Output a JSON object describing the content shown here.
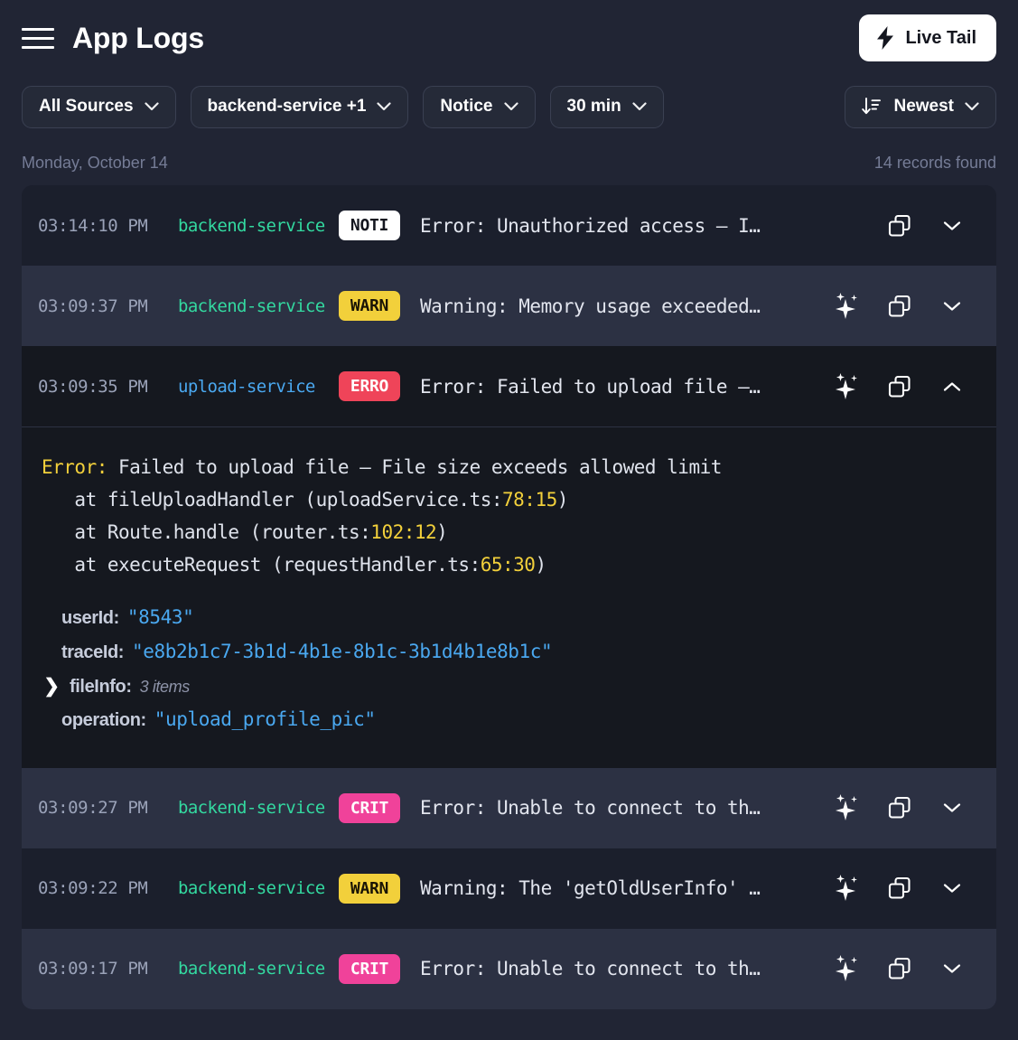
{
  "header": {
    "menu_icon": "hamburger-icon",
    "title": "App Logs",
    "live_tail_label": "Live Tail",
    "live_tail_icon": "bolt-icon"
  },
  "filters": [
    {
      "label": "All Sources",
      "icon": "chevron-down-icon"
    },
    {
      "label": "backend-service +1",
      "icon": "chevron-down-icon"
    },
    {
      "label": "Notice",
      "icon": "chevron-down-icon"
    },
    {
      "label": "30 min",
      "icon": "chevron-down-icon"
    }
  ],
  "sort": {
    "label": "Newest",
    "lead_icon": "sort-descending-icon",
    "icon": "chevron-down-icon"
  },
  "meta": {
    "date": "Monday, October 14",
    "records": "14 records found"
  },
  "colors": {
    "page_bg": "#212534",
    "row_bg": "#1b1f2c",
    "row_bg_alt": "#2c3143",
    "detail_bg": "#15181f",
    "source_green": "#33d9a0",
    "source_blue": "#4aa8f0",
    "noti": "#ffffff",
    "warn": "#f2d03b",
    "erro": "#ef4459",
    "crit": "#f0429a",
    "value_blue": "#4aa8f0",
    "accent_yellow": "#f2d03b"
  },
  "rows": [
    {
      "time": "03:14:10 PM",
      "source": "backend-service",
      "source_color": "green",
      "level": "NOTI",
      "level_class": "noti",
      "message": "Error: Unauthorized access — I…",
      "has_sparkle": false,
      "copy_icon": "copy-icon",
      "toggle_icon": "chevron-down-icon",
      "expanded": false
    },
    {
      "time": "03:09:37 PM",
      "source": "backend-service",
      "source_color": "green",
      "level": "WARN",
      "level_class": "warn",
      "message": "Warning: Memory usage exceeded…",
      "has_sparkle": true,
      "sparkle_icon": "sparkles-icon",
      "copy_icon": "copy-icon",
      "toggle_icon": "chevron-down-icon",
      "expanded": false
    },
    {
      "time": "03:09:35 PM",
      "source": "upload-service",
      "source_color": "blue",
      "level": "ERRO",
      "level_class": "erro",
      "message": "Error: Failed to upload file —…",
      "has_sparkle": true,
      "sparkle_icon": "sparkles-icon",
      "copy_icon": "copy-icon",
      "toggle_icon": "chevron-up-icon",
      "expanded": true
    },
    {
      "time": "03:09:27 PM",
      "source": "backend-service",
      "source_color": "green",
      "level": "CRIT",
      "level_class": "crit",
      "message": "Error: Unable to connect to th…",
      "has_sparkle": true,
      "sparkle_icon": "sparkles-icon",
      "copy_icon": "copy-icon",
      "toggle_icon": "chevron-down-icon",
      "expanded": false
    },
    {
      "time": "03:09:22 PM",
      "source": "backend-service",
      "source_color": "green",
      "level": "WARN",
      "level_class": "warn",
      "message": "Warning: The 'getOldUserInfo' …",
      "has_sparkle": true,
      "sparkle_icon": "sparkles-icon",
      "copy_icon": "copy-icon",
      "toggle_icon": "chevron-down-icon",
      "expanded": false
    },
    {
      "time": "03:09:17 PM",
      "source": "backend-service",
      "source_color": "green",
      "level": "CRIT",
      "level_class": "crit",
      "message": "Error: Unable to connect to th…",
      "has_sparkle": true,
      "sparkle_icon": "sparkles-icon",
      "copy_icon": "copy-icon",
      "toggle_icon": "chevron-down-icon",
      "expanded": false
    }
  ],
  "detail": {
    "error_label": "Error:",
    "error_message": " Failed to upload file — File size exceeds allowed limit",
    "stack": [
      {
        "text": "   at fileUploadHandler (uploadService.ts:",
        "num": "78:15",
        "tail": ")"
      },
      {
        "text": "   at Route.handle (router.ts:",
        "num": "102:12",
        "tail": ")"
      },
      {
        "text": "   at executeRequest (requestHandler.ts:",
        "num": "65:30",
        "tail": ")"
      }
    ],
    "fields": [
      {
        "key": "userId:",
        "value": "\"8543\""
      },
      {
        "key": "traceId:",
        "value": "\"e8b2b1c7-3b1d-4b1e-8b1c-3b1d4b1e8b1c\""
      }
    ],
    "collapsible": {
      "twisty": "❯",
      "key": "fileInfo:",
      "items": "3 items"
    },
    "last_field": {
      "key": "operation:",
      "value": "\"upload_profile_pic\""
    }
  }
}
